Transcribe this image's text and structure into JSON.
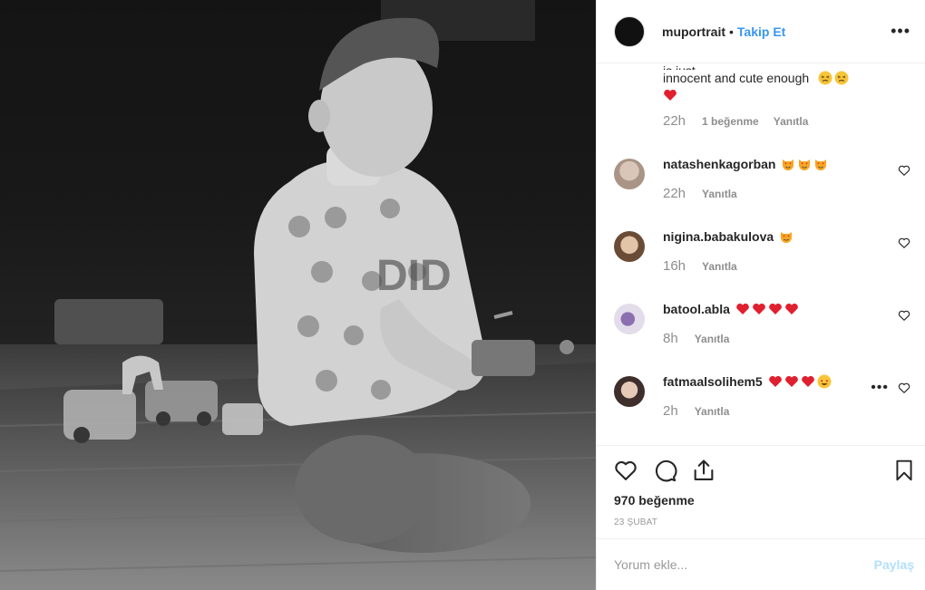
{
  "header": {
    "username": "muportrait",
    "separator": "•",
    "follow_label": "Takip Et",
    "more_icon": "more-horizontal-icon",
    "more_label": "•••"
  },
  "photo": {
    "description_icon": "photo",
    "letters": "DID"
  },
  "top_comment": {
    "clipped_text": "is just...",
    "text": "innocent and cute enough",
    "time": "22h",
    "likes": "1 beğenme",
    "reply_label": "Yanıtla"
  },
  "comments": [
    {
      "username": "natashenkagorban",
      "time": "22h",
      "reply_label": "Yanıtla",
      "emojis": [
        "heart-eyes-cat",
        "heart-eyes-cat",
        "heart-eyes-cat"
      ],
      "avatar_color": "#b8a89a"
    },
    {
      "username": "nigina.babakulova",
      "time": "16h",
      "reply_label": "Yanıtla",
      "emojis": [
        "heart-eyes-cat"
      ],
      "avatar_color": "#9a7b63"
    },
    {
      "username": "batool.abla",
      "time": "8h",
      "reply_label": "Yanıtla",
      "emojis": [
        "red-heart",
        "red-heart",
        "red-heart",
        "red-heart"
      ],
      "avatar_color": "#c5bfd8"
    },
    {
      "username": "fatmaalsolihem5",
      "time": "2h",
      "reply_label": "Yanıtla",
      "emojis": [
        "red-heart",
        "red-heart",
        "red-heart",
        "heart-eyes"
      ],
      "avatar_color": "#6b5a55"
    }
  ],
  "comment_more_label": "•••",
  "likes_text": "970 beğenme",
  "date_text": "23 ŞUBAT",
  "add_comment": {
    "placeholder": "Yorum ekle...",
    "post_label": "Paylaş"
  },
  "colors": {
    "link_blue": "#3897f0",
    "post_disabled": "#b2dffc",
    "heart_red": "#ed4956",
    "muted": "#8e8e8e"
  }
}
